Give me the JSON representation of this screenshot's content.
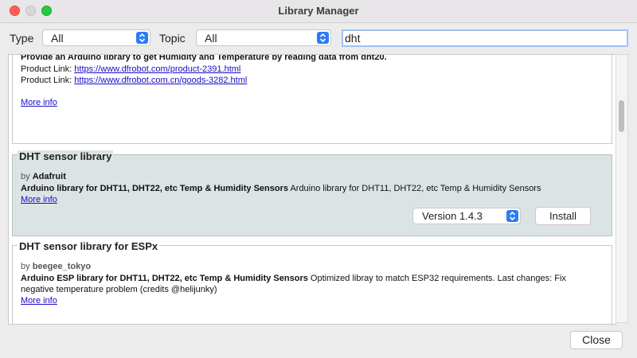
{
  "window": {
    "title": "Library Manager"
  },
  "filters": {
    "type_label": "Type",
    "type_value": "All",
    "topic_label": "Topic",
    "topic_value": "All",
    "search_value": "dht"
  },
  "libraries": [
    {
      "description_tail": "Provide an Arduino library to get Humidity and Temperature by reading data from dht20.",
      "product_links": [
        {
          "label": "Product Link:",
          "url": "https://www.dfrobot.com/product-2391.html"
        },
        {
          "label": "Product Link:",
          "url": "https://www.dfrobot.com.cn/goods-3282.html"
        }
      ],
      "more_info": "More info"
    },
    {
      "name": "DHT sensor library",
      "by_prefix": "by",
      "author": "Adafruit",
      "sentence": "Arduino library for DHT11, DHT22, etc Temp & Humidity Sensors",
      "paragraph": "Arduino library for DHT11, DHT22, etc Temp & Humidity Sensors",
      "more_info": "More info",
      "version": "Version 1.4.3",
      "install_label": "Install"
    },
    {
      "name": "DHT sensor library for ESPx",
      "by_prefix": "by",
      "author": "beegee_tokyo",
      "sentence": "Arduino ESP library for DHT11, DHT22, etc Temp & Humidity Sensors",
      "paragraph": "Optimized libray to match ESP32 requirements. Last changes: Fix",
      "paragraph_2": "negative temperature problem (credits @helijunky)",
      "more_info": "More info"
    }
  ],
  "footer": {
    "close_label": "Close"
  },
  "colors": {
    "accent": "#2b7bf5",
    "link": "#1a0dc4",
    "selected_bg": "#dce3e4"
  }
}
